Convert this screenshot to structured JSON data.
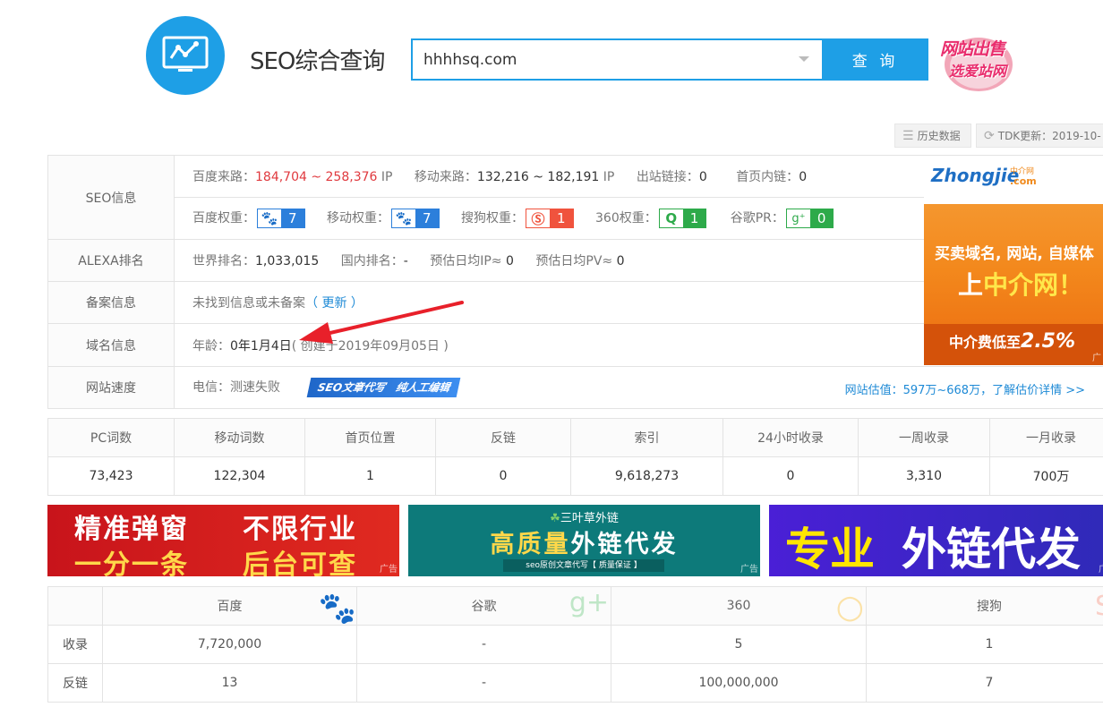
{
  "header": {
    "site_title": "SEO综合查询",
    "search_value": "hhhhsq.com",
    "search_button": "查 询",
    "sale_line1": "网站出售",
    "sale_line2": "选爱站网"
  },
  "toolbar": {
    "history": "历史数据",
    "tdk": "TDK更新：2019-10-"
  },
  "seo": {
    "label": "SEO信息",
    "baidu_traffic_label": "百度来路：",
    "baidu_traffic_value": "184,704 ~ 258,376",
    "ip_unit": "IP",
    "mobile_traffic_label": "移动来路：",
    "mobile_traffic_value": "132,216 ~ 182,191",
    "outlinks_label": "出站链接：",
    "outlinks_value": "0",
    "homepage_links_label": "首页内链：",
    "homepage_links_value": "0",
    "baidu_weight_label": "百度权重：",
    "baidu_weight_value": "7",
    "mobile_weight_label": "移动权重：",
    "mobile_weight_value": "7",
    "sogou_weight_label": "搜狗权重：",
    "sogou_weight_value": "1",
    "so360_weight_label": "360权重：",
    "so360_weight_value": "1",
    "google_pr_label": "谷歌PR：",
    "google_pr_value": "0"
  },
  "alexa": {
    "label": "ALEXA排名",
    "world_label": "世界排名：",
    "world_value": "1,033,015",
    "domestic_label": "国内排名：",
    "domestic_value": "-",
    "daily_ip_label": "预估日均IP≈",
    "daily_ip_value": "0",
    "daily_pv_label": "预估日均PV≈",
    "daily_pv_value": "0"
  },
  "beian": {
    "label": "备案信息",
    "text": "未找到信息或未备案",
    "update_link": "（ 更新 ）"
  },
  "domain": {
    "label": "域名信息",
    "age_label": "年龄：",
    "age_value": "0年1月4日",
    "created": "( 创建于2019年09月05日 )"
  },
  "speed": {
    "label": "网站速度",
    "telecom": "电信：测速失败",
    "tag1": "SEO文章代写",
    "tag2": "纯人工编辑",
    "valuation": "网站估值：597万~668万，了解估价详情 >>"
  },
  "side_ad": {
    "brand": "Zhongjie",
    "brand_suffix": ".com",
    "brand_small": "中介网",
    "line1": "买卖域名, 网站, 自媒体",
    "line2a": "上",
    "line2b": "中介网！",
    "line3a": "中介费低至",
    "line3b": "2.5%",
    "tag": "广"
  },
  "stats": {
    "headers": [
      "PC词数",
      "移动词数",
      "首页位置",
      "反链",
      "索引",
      "24小时收录",
      "一周收录",
      "一月收录"
    ],
    "values": [
      "73,423",
      "122,304",
      "1",
      "0",
      "9,618,273",
      "0",
      "3,310",
      "700万"
    ]
  },
  "banners": {
    "b1": {
      "l1a": "精准弹窗",
      "l1b": "不限行业",
      "l2a": "一分一条",
      "l2b": "后台可查",
      "tag": "广告"
    },
    "b2": {
      "top": "三叶草外链",
      "main_a": "高质量",
      "main_b": "外链代发",
      "sub": "seo原创文章代写【 质量保证 】",
      "tag": "广告"
    },
    "b3": {
      "a": "专业",
      "b": "外链代发",
      "tag": "广"
    }
  },
  "engines": {
    "headers": [
      "百度",
      "谷歌",
      "360",
      "搜狗"
    ],
    "rows": [
      {
        "label": "收录",
        "values": [
          "7,720,000",
          "-",
          "5",
          "1"
        ]
      },
      {
        "label": "反链",
        "values": [
          "13",
          "-",
          "100,000,000",
          "7"
        ]
      }
    ]
  },
  "colors": {
    "primary": "#1e9fe6",
    "red": "#e0393e",
    "baidu_blue": "#2c7fdb",
    "sogou_red": "#f0533d",
    "so360_green": "#2daa4a",
    "google_green": "#2daa4a"
  }
}
